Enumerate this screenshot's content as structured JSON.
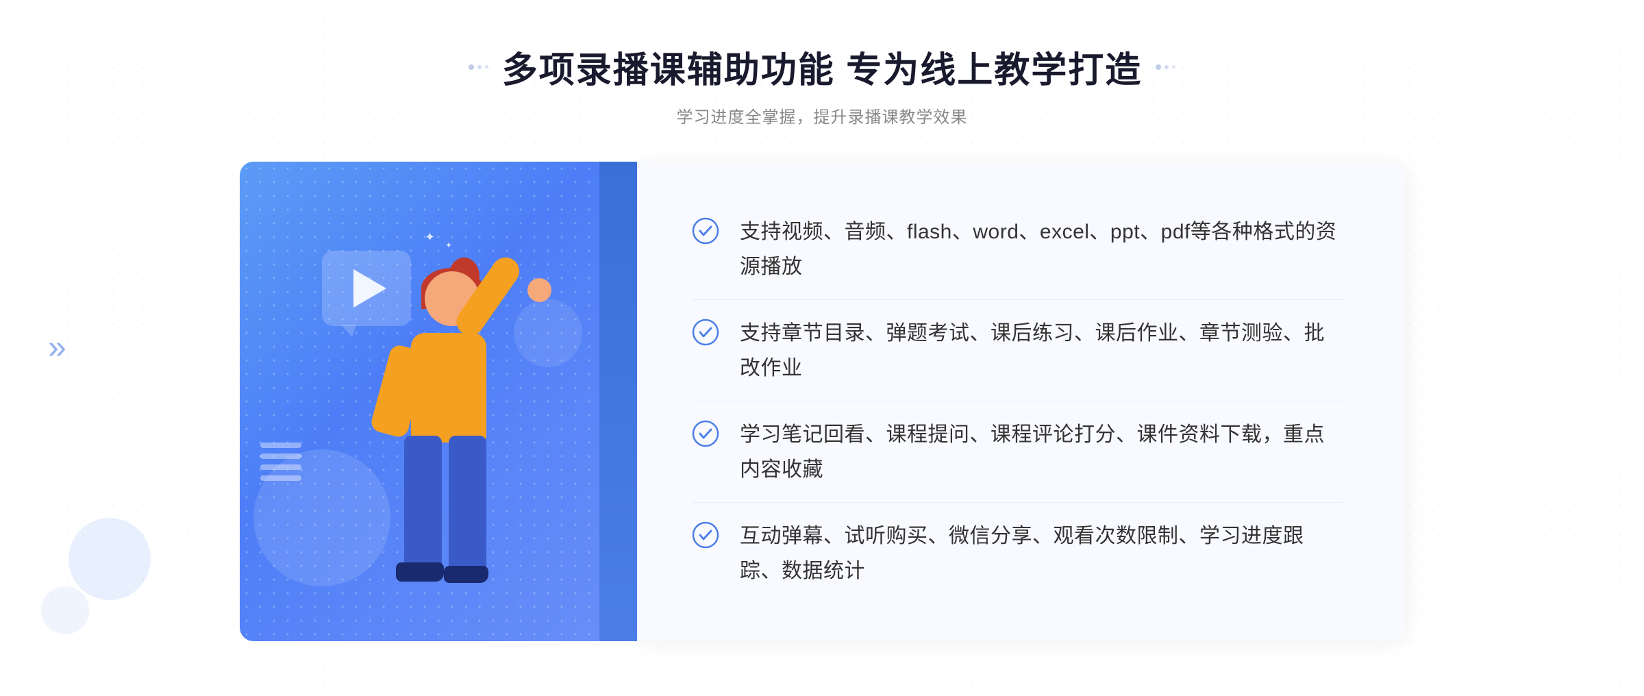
{
  "header": {
    "title": "多项录播课辅助功能 专为线上教学打造",
    "subtitle": "学习进度全掌握，提升录播课教学效果",
    "dot_decoration_left": "dots-left",
    "dot_decoration_right": "dots-right"
  },
  "features": [
    {
      "id": 1,
      "text": "支持视频、音频、flash、word、excel、ppt、pdf等各种格式的资源播放"
    },
    {
      "id": 2,
      "text": "支持章节目录、弹题考试、课后练习、课后作业、章节测验、批改作业"
    },
    {
      "id": 3,
      "text": "学习笔记回看、课程提问、课程评论打分、课件资料下载，重点内容收藏"
    },
    {
      "id": 4,
      "text": "互动弹幕、试听购买、微信分享、观看次数限制、学习进度跟踪、数据统计"
    }
  ],
  "colors": {
    "accent_blue": "#4a7de8",
    "title_dark": "#1a1a2e",
    "text_gray": "#888888",
    "feature_text": "#333333",
    "check_blue": "#4a7de8",
    "panel_bg": "#f8faff"
  },
  "chevron_left": "»"
}
